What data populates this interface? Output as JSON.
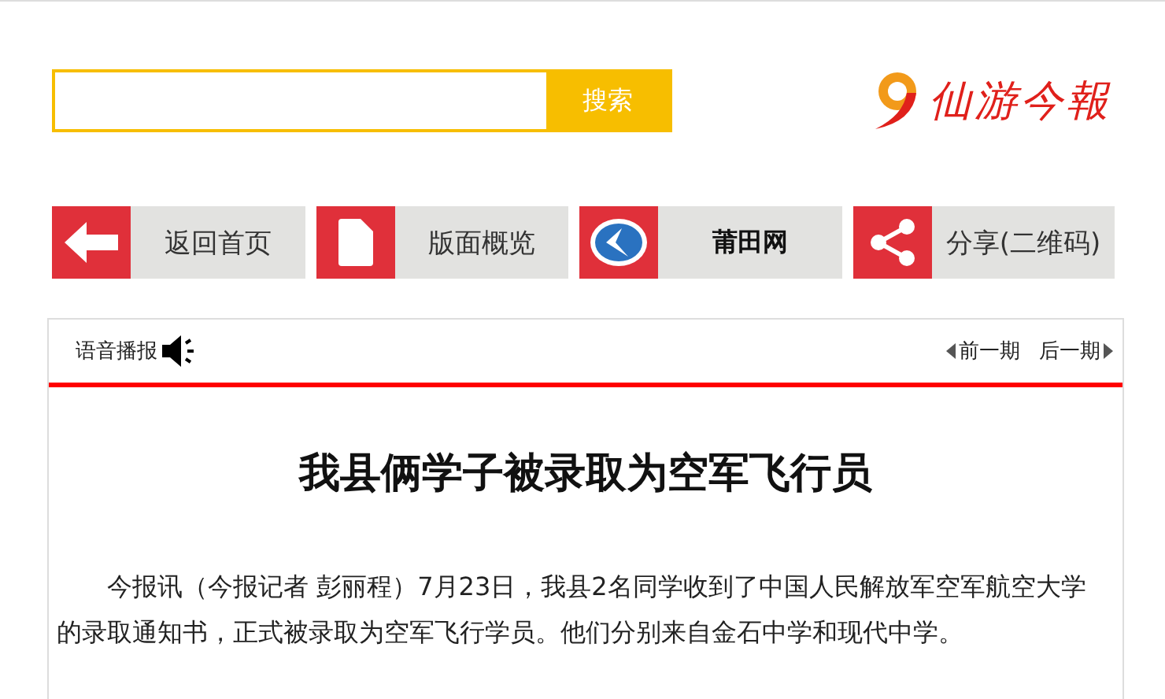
{
  "search": {
    "button": "搜索"
  },
  "logo": {
    "text": "仙游今報"
  },
  "nav": [
    {
      "kind": "back",
      "label": "返回首页"
    },
    {
      "kind": "page",
      "label": "版面概览"
    },
    {
      "kind": "site",
      "label": "莆田网"
    },
    {
      "kind": "share",
      "label": "分享(二维码)"
    }
  ],
  "article": {
    "voice": "语音播报",
    "prev": "前一期",
    "next": "后一期",
    "title": "我县俩学子被录取为空军飞行员",
    "paragraphs": [
      "今报讯（今报记者 彭丽程）7月23日，我县2名同学收到了中国人民解放军空军航空大学的录取通知书，正式被录取为空军飞行学员。他们分别来自金石中学和现代中学。"
    ]
  }
}
